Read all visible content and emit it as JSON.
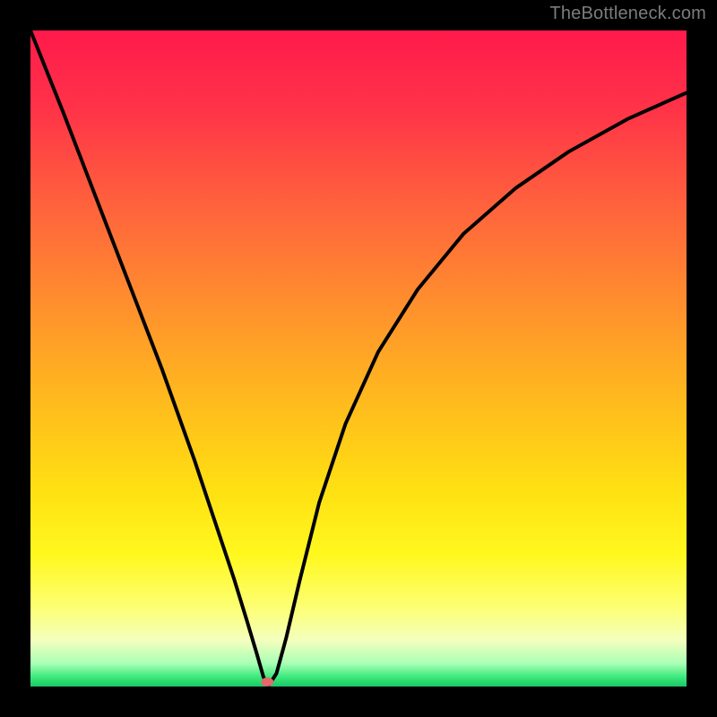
{
  "attribution": "TheBottleneck.com",
  "gradient": {
    "stops": [
      {
        "offset": 0.0,
        "color": "#ff1a4b"
      },
      {
        "offset": 0.12,
        "color": "#ff3348"
      },
      {
        "offset": 0.25,
        "color": "#ff5d3e"
      },
      {
        "offset": 0.4,
        "color": "#ff8a2f"
      },
      {
        "offset": 0.55,
        "color": "#ffb61f"
      },
      {
        "offset": 0.7,
        "color": "#ffe012"
      },
      {
        "offset": 0.8,
        "color": "#fff81f"
      },
      {
        "offset": 0.88,
        "color": "#fdff74"
      },
      {
        "offset": 0.93,
        "color": "#f4ffbe"
      },
      {
        "offset": 0.965,
        "color": "#a8ffb5"
      },
      {
        "offset": 0.985,
        "color": "#3fe97d"
      },
      {
        "offset": 1.0,
        "color": "#18c864"
      }
    ]
  },
  "curve_style": {
    "stroke": "#000000",
    "width": 4
  },
  "minimum_marker": {
    "x_frac": 0.361,
    "y_frac": 0.993,
    "color": "#e26a6a",
    "rx": 7,
    "ry": 5
  },
  "chart_data": {
    "type": "line",
    "title": "",
    "xlabel": "",
    "ylabel": "",
    "xlim": [
      0,
      1
    ],
    "ylim": [
      0,
      1
    ],
    "note": "Axes have no visible tick labels; x and y are normalized plot coordinates. y=1 is top (high bottleneck), y≈0 is bottom (no bottleneck). Curve shows a sharp V-shaped minimum near x≈0.36.",
    "series": [
      {
        "name": "bottleneck-curve",
        "x": [
          0.0,
          0.05,
          0.1,
          0.15,
          0.2,
          0.25,
          0.28,
          0.31,
          0.33,
          0.345,
          0.355,
          0.362,
          0.375,
          0.39,
          0.41,
          0.44,
          0.48,
          0.53,
          0.59,
          0.66,
          0.74,
          0.82,
          0.91,
          1.0
        ],
        "y": [
          1.0,
          0.875,
          0.745,
          0.615,
          0.485,
          0.345,
          0.255,
          0.165,
          0.1,
          0.05,
          0.015,
          0.0,
          0.02,
          0.075,
          0.16,
          0.28,
          0.4,
          0.51,
          0.605,
          0.69,
          0.76,
          0.815,
          0.865,
          0.905
        ]
      }
    ],
    "minimum": {
      "x": 0.362,
      "y": 0.0
    }
  }
}
